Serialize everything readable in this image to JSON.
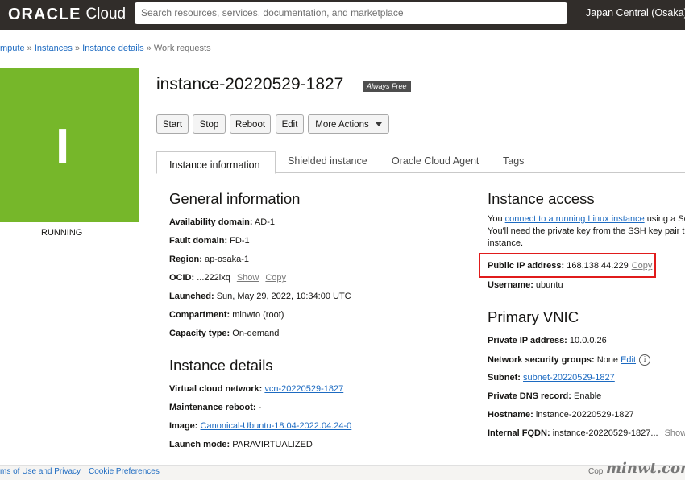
{
  "header": {
    "logo_brand": "ORACLE",
    "logo_product": "Cloud",
    "search_placeholder": "Search resources, services, documentation, and marketplace",
    "region": "Japan Central (Osaka) ⌄"
  },
  "breadcrumb": {
    "items": [
      "mpute",
      "Instances",
      "Instance details"
    ],
    "current": "Work requests",
    "separator": "»"
  },
  "instance": {
    "initial": "I",
    "tile_color": "#76b72a",
    "status": "RUNNING",
    "name": "instance-20220529-1827",
    "badge": "Always Free"
  },
  "actions": {
    "start": "Start",
    "stop": "Stop",
    "reboot": "Reboot",
    "edit": "Edit",
    "more": "More Actions"
  },
  "tabs": [
    "Instance information",
    "Shielded instance",
    "Oracle Cloud Agent",
    "Tags"
  ],
  "general": {
    "heading": "General information",
    "availability_label": "Availability domain:",
    "availability_value": "AD-1",
    "fault_label": "Fault domain:",
    "fault_value": "FD-1",
    "region_label": "Region:",
    "region_value": "ap-osaka-1",
    "ocid_label": "OCID:",
    "ocid_value": "...222ixq",
    "ocid_show": "Show",
    "ocid_copy": "Copy",
    "launched_label": "Launched:",
    "launched_value": "Sun, May 29, 2022, 10:34:00 UTC",
    "compartment_label": "Compartment:",
    "compartment_value": "minwto (root)",
    "capacity_label": "Capacity type:",
    "capacity_value": "On-demand"
  },
  "details": {
    "heading": "Instance details",
    "vcn_label": "Virtual cloud network:",
    "vcn_value": "vcn-20220529-1827",
    "maint_label": "Maintenance reboot:",
    "maint_value": "-",
    "image_label": "Image:",
    "image_value": "Canonical-Ubuntu-18.04-2022.04.24-0",
    "launch_mode_label": "Launch mode:",
    "launch_mode_value": "PARAVIRTUALIZED"
  },
  "access": {
    "heading": "Instance access",
    "line1_prefix": "You ",
    "line1_link": "connect to a running Linux instance",
    "line1_suffix": " using a Se",
    "line2": "You'll need the private key from the SSH key pair th",
    "line3": "instance.",
    "ip_label": "Public IP address:",
    "ip_value": "168.138.44.229",
    "ip_copy": "Copy",
    "user_label": "Username:",
    "user_value": "ubuntu"
  },
  "vnic": {
    "heading": "Primary VNIC",
    "private_ip_label": "Private IP address:",
    "private_ip_value": "10.0.0.26",
    "nsg_label": "Network security groups:",
    "nsg_value": "None",
    "nsg_edit": "Edit",
    "subnet_label": "Subnet:",
    "subnet_value": "subnet-20220529-1827",
    "dns_label": "Private DNS record:",
    "dns_value": "Enable",
    "hostname_label": "Hostname:",
    "hostname_value": "instance-20220529-1827",
    "fqdn_label": "Internal FQDN:",
    "fqdn_value": "instance-20220529-1827...",
    "fqdn_show": "Show"
  },
  "footer": {
    "terms": "ms of Use and Privacy",
    "cookies": "Cookie Preferences",
    "copyright": "Cop"
  },
  "watermark": "minwt.com"
}
